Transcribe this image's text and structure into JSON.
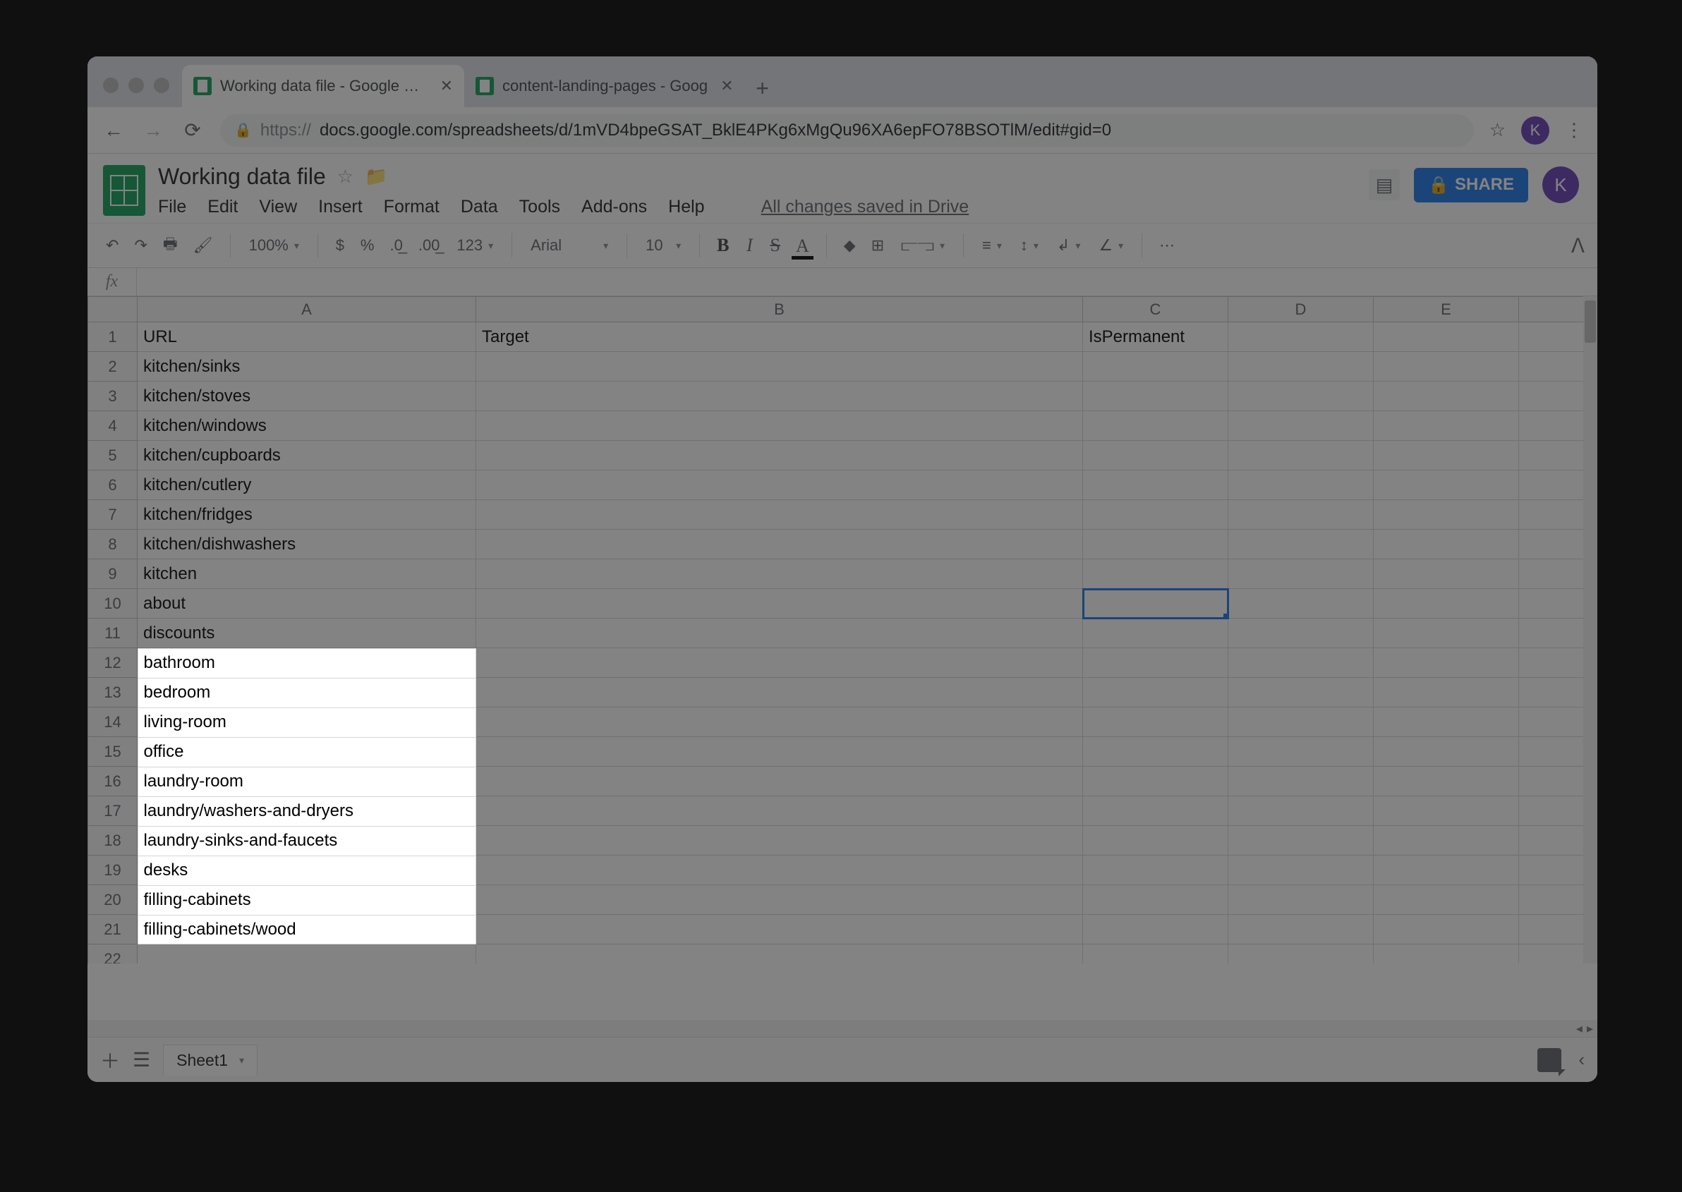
{
  "browser": {
    "tabs": [
      {
        "label": "Working data file - Google She"
      },
      {
        "label": "content-landing-pages - Goog"
      }
    ],
    "url_prefix": "https://",
    "url_rest": "docs.google.com/spreadsheets/d/1mVD4bpeGSAT_BklE4PKg6xMgQu96XA6epFO78BSOTlM/edit#gid=0",
    "avatar_letter": "K"
  },
  "sheets": {
    "doc_title": "Working data file",
    "menus": [
      "File",
      "Edit",
      "View",
      "Insert",
      "Format",
      "Data",
      "Tools",
      "Add-ons",
      "Help"
    ],
    "save_status": "All changes saved in Drive",
    "share_label": "SHARE",
    "avatar_letter": "K",
    "toolbar": {
      "zoom": "100%",
      "numfmt": "123",
      "font": "Arial",
      "size": "10"
    },
    "sheet_tab": "Sheet1"
  },
  "grid": {
    "columns": [
      "A",
      "B",
      "C",
      "D",
      "E"
    ],
    "headers": {
      "A": "URL",
      "B": "Target",
      "C": "IsPermanent"
    },
    "active_cell": "C10",
    "rows": [
      {
        "n": 1,
        "A": "URL",
        "B": "Target",
        "C": "IsPermanent",
        "hl": false,
        "header": true
      },
      {
        "n": 2,
        "A": "kitchen/sinks",
        "hl": false
      },
      {
        "n": 3,
        "A": "kitchen/stoves",
        "hl": false
      },
      {
        "n": 4,
        "A": "kitchen/windows",
        "hl": false
      },
      {
        "n": 5,
        "A": "kitchen/cupboards",
        "hl": false
      },
      {
        "n": 6,
        "A": "kitchen/cutlery",
        "hl": false
      },
      {
        "n": 7,
        "A": "kitchen/fridges",
        "hl": false
      },
      {
        "n": 8,
        "A": "kitchen/dishwashers",
        "hl": false
      },
      {
        "n": 9,
        "A": "kitchen",
        "hl": false
      },
      {
        "n": 10,
        "A": "about",
        "hl": false,
        "active_c": true
      },
      {
        "n": 11,
        "A": "discounts",
        "hl": false
      },
      {
        "n": 12,
        "A": "bathroom",
        "hl": true
      },
      {
        "n": 13,
        "A": "bedroom",
        "hl": true
      },
      {
        "n": 14,
        "A": "living-room",
        "hl": true
      },
      {
        "n": 15,
        "A": "office",
        "hl": true
      },
      {
        "n": 16,
        "A": "laundry-room",
        "hl": true
      },
      {
        "n": 17,
        "A": "laundry/washers-and-dryers",
        "hl": true
      },
      {
        "n": 18,
        "A": "laundry-sinks-and-faucets",
        "hl": true
      },
      {
        "n": 19,
        "A": "desks",
        "hl": true
      },
      {
        "n": 20,
        "A": "filling-cabinets",
        "hl": true
      },
      {
        "n": 21,
        "A": "filling-cabinets/wood",
        "hl": true
      },
      {
        "n": 22,
        "A": "",
        "hl": false
      }
    ]
  }
}
